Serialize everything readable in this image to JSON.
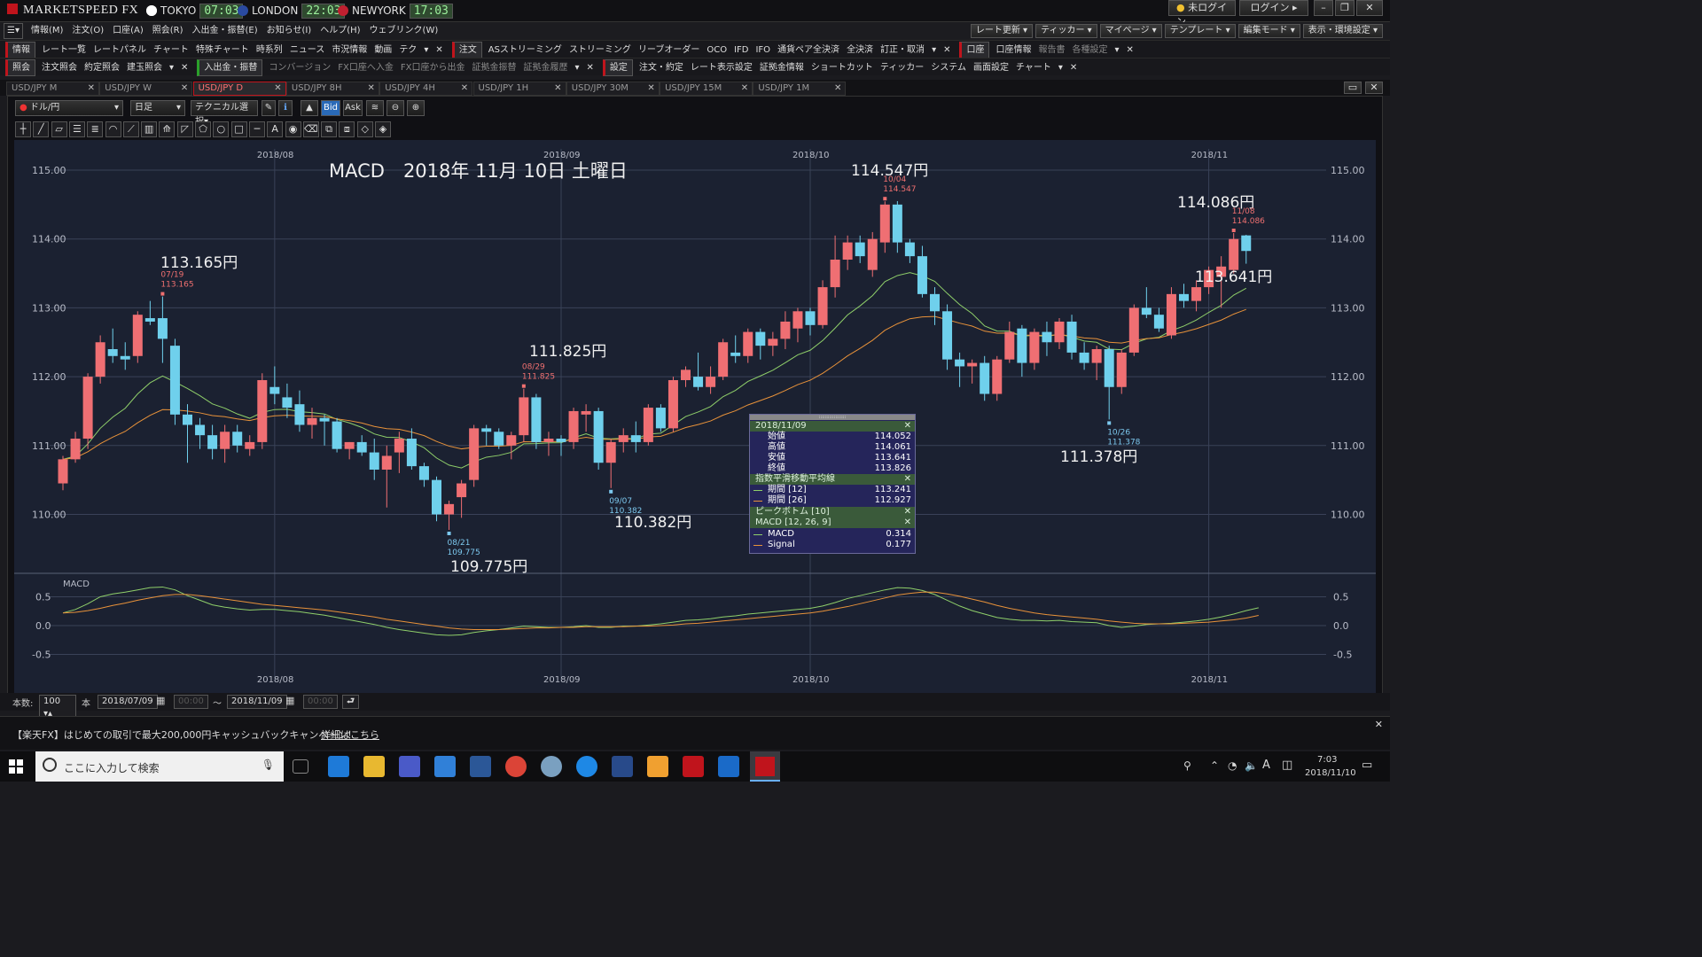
{
  "app": {
    "title": "MARKETSPEED FX",
    "clocks": [
      {
        "city": "TOKYO",
        "time": "07:03",
        "flag_color": "#e02020"
      },
      {
        "city": "LONDON",
        "time": "22:03",
        "flag_color": "#2a4aa0"
      },
      {
        "city": "NEWYORK",
        "time": "17:03",
        "flag_color": "#c02030"
      }
    ],
    "login_status": "未ログイン",
    "login_button": "ログイン",
    "menu": [
      "情報(M)",
      "注文(O)",
      "口座(A)",
      "照会(R)",
      "入出金・振替(E)",
      "お知らせ(I)",
      "ヘルプ(H)",
      "ウェブリンク(W)"
    ],
    "right_buttons": [
      "レート更新",
      "ティッカー",
      "マイページ",
      "テンプレート",
      "編集モード",
      "表示・環境設定"
    ]
  },
  "toolbar1": {
    "info_head": "情報",
    "info_items": [
      "レート一覧",
      "レートパネル",
      "チャート",
      "特殊チャート",
      "時系列",
      "ニュース",
      "市況情報",
      "動画",
      "テク"
    ],
    "order_head": "注文",
    "order_items": [
      "ASストリーミング",
      "ストリーミング",
      "リーブオーダー",
      "OCO",
      "IFD",
      "IFO",
      "通貨ペア全決済",
      "全決済",
      "訂正・取消"
    ],
    "account_head": "口座",
    "account_items": [
      "口座情報",
      "報告書",
      "各種設定"
    ]
  },
  "toolbar2": {
    "inquiry_head": "照会",
    "inquiry_items": [
      "注文照会",
      "約定照会",
      "建玉照会"
    ],
    "deposit_head": "入出金・振替",
    "deposit_items": [
      "コンバージョン",
      "FX口座へ入金",
      "FX口座から出金",
      "証拠金振替",
      "証拠金履歴"
    ],
    "settings_head": "設定",
    "settings_items": [
      "注文・約定",
      "レート表示設定",
      "証拠金情報",
      "ショートカット",
      "ティッカー",
      "システム",
      "画面設定",
      "チャート"
    ]
  },
  "tabs": [
    {
      "label": "USD/JPY M",
      "active": false
    },
    {
      "label": "USD/JPY W",
      "active": false
    },
    {
      "label": "USD/JPY D",
      "active": true
    },
    {
      "label": "USD/JPY 8H",
      "active": false
    },
    {
      "label": "USD/JPY 4H",
      "active": false
    },
    {
      "label": "USD/JPY 1H",
      "active": false
    },
    {
      "label": "USD/JPY 30M",
      "active": false
    },
    {
      "label": "USD/JPY 15M",
      "active": false
    },
    {
      "label": "USD/JPY 1M",
      "active": false
    }
  ],
  "chart_controls": {
    "pair": "ドル/円",
    "period": "日足",
    "technical": "テクニカル選択",
    "bid": "Bid",
    "ask": "Ask"
  },
  "annotations": {
    "title": "MACD　2018年 11月 10日 土曜日",
    "labels": [
      {
        "text": "113.165円"
      },
      {
        "text": "111.825円"
      },
      {
        "text": "114.547円"
      },
      {
        "text": "114.086円"
      },
      {
        "text": "113.641円"
      },
      {
        "text": "110.382円"
      },
      {
        "text": "109.775円"
      },
      {
        "text": "111.378円"
      }
    ],
    "peaks": [
      {
        "date": "07/19",
        "value": "113.165",
        "kind": "high"
      },
      {
        "date": "08/29",
        "value": "111.825",
        "kind": "high"
      },
      {
        "date": "10/04",
        "value": "114.547",
        "kind": "high"
      },
      {
        "date": "11/08",
        "value": "114.086",
        "kind": "high"
      },
      {
        "date": "08/21",
        "value": "109.775",
        "kind": "low"
      },
      {
        "date": "09/07",
        "value": "110.382",
        "kind": "low"
      },
      {
        "date": "10/26",
        "value": "111.378",
        "kind": "low"
      }
    ]
  },
  "data_window": {
    "date": "2018/11/09",
    "ohlc": [
      {
        "label": "始値",
        "value": "114.052"
      },
      {
        "label": "高値",
        "value": "114.061"
      },
      {
        "label": "安値",
        "value": "113.641"
      },
      {
        "label": "終値",
        "value": "113.826"
      }
    ],
    "ema_title": "指数平滑移動平均線",
    "ema": [
      {
        "label": "期間 [12]",
        "value": "113.241"
      },
      {
        "label": "期間 [26]",
        "value": "112.927"
      }
    ],
    "peak_title": "ピークボトム [10]",
    "macd_title": "MACD [12, 26, 9]",
    "macd": [
      {
        "label": "MACD",
        "value": "0.314"
      },
      {
        "label": "Signal",
        "value": "0.177"
      }
    ]
  },
  "bottom": {
    "count_label": "本数:",
    "count": "100",
    "unit": "本",
    "from": "2018/07/09",
    "to": "2018/11/09",
    "time_placeholder": "00:00",
    "tilde": "～"
  },
  "news": {
    "text": "【楽天FX】はじめての取引で最大200,000円キャッシュバックキャンペーン！",
    "link": "詳細はこちら"
  },
  "taskbar": {
    "search": "ここに入力して検索",
    "time": "7:03",
    "date": "2018/11/10"
  },
  "colors": {
    "up": "#ef6f73",
    "down": "#6fd0ec",
    "ema12": "#8fcf6a",
    "ema26": "#e8923a",
    "bg": "#1b2131",
    "grid": "#3a4258"
  },
  "chart_data": {
    "type": "candlestick",
    "title": "MACD　2018年 11月 10日 土曜日",
    "pair": "USD/JPY",
    "timeframe": "日足",
    "x_month_labels": [
      "2018/08",
      "2018/09",
      "2018/10",
      "2018/11"
    ],
    "ylim": [
      109.5,
      115.2
    ],
    "yticks": [
      "110.00",
      "111.00",
      "112.00",
      "113.00",
      "114.00",
      "115.00"
    ],
    "candles": [
      {
        "o": 110.45,
        "h": 110.85,
        "l": 110.35,
        "c": 110.8
      },
      {
        "o": 110.8,
        "h": 111.2,
        "l": 110.75,
        "c": 111.1
      },
      {
        "o": 111.1,
        "h": 112.05,
        "l": 110.95,
        "c": 112.0
      },
      {
        "o": 112.0,
        "h": 112.6,
        "l": 111.9,
        "c": 112.5
      },
      {
        "o": 112.4,
        "h": 112.7,
        "l": 112.2,
        "c": 112.3
      },
      {
        "o": 112.3,
        "h": 112.5,
        "l": 112.1,
        "c": 112.25
      },
      {
        "o": 112.3,
        "h": 112.95,
        "l": 112.2,
        "c": 112.9
      },
      {
        "o": 112.85,
        "h": 113.1,
        "l": 112.75,
        "c": 112.8
      },
      {
        "o": 112.85,
        "h": 113.165,
        "l": 112.2,
        "c": 112.55
      },
      {
        "o": 112.45,
        "h": 112.55,
        "l": 111.3,
        "c": 111.45
      },
      {
        "o": 111.45,
        "h": 111.6,
        "l": 110.75,
        "c": 111.3
      },
      {
        "o": 111.3,
        "h": 111.4,
        "l": 110.95,
        "c": 111.15
      },
      {
        "o": 111.15,
        "h": 111.3,
        "l": 110.8,
        "c": 110.95
      },
      {
        "o": 110.95,
        "h": 111.3,
        "l": 110.75,
        "c": 111.2
      },
      {
        "o": 111.2,
        "h": 111.3,
        "l": 110.9,
        "c": 111.0
      },
      {
        "o": 110.95,
        "h": 111.15,
        "l": 110.85,
        "c": 111.05
      },
      {
        "o": 111.05,
        "h": 112.05,
        "l": 110.95,
        "c": 111.95
      },
      {
        "o": 111.85,
        "h": 112.15,
        "l": 111.6,
        "c": 111.75
      },
      {
        "o": 111.7,
        "h": 111.9,
        "l": 111.4,
        "c": 111.55
      },
      {
        "o": 111.6,
        "h": 111.8,
        "l": 111.2,
        "c": 111.3
      },
      {
        "o": 111.3,
        "h": 111.55,
        "l": 111.1,
        "c": 111.4
      },
      {
        "o": 111.4,
        "h": 111.45,
        "l": 111.0,
        "c": 111.35
      },
      {
        "o": 111.35,
        "h": 111.4,
        "l": 110.9,
        "c": 110.95
      },
      {
        "o": 110.95,
        "h": 111.05,
        "l": 110.8,
        "c": 111.05
      },
      {
        "o": 111.05,
        "h": 111.15,
        "l": 110.85,
        "c": 110.9
      },
      {
        "o": 110.9,
        "h": 111.1,
        "l": 110.5,
        "c": 110.65
      },
      {
        "o": 110.65,
        "h": 111.0,
        "l": 110.1,
        "c": 110.85
      },
      {
        "o": 110.9,
        "h": 111.2,
        "l": 110.6,
        "c": 111.1
      },
      {
        "o": 111.1,
        "h": 111.25,
        "l": 110.65,
        "c": 110.7
      },
      {
        "o": 110.7,
        "h": 110.75,
        "l": 110.4,
        "c": 110.5
      },
      {
        "o": 110.5,
        "h": 110.55,
        "l": 109.9,
        "c": 110.0
      },
      {
        "o": 110.0,
        "h": 110.2,
        "l": 109.775,
        "c": 110.15
      },
      {
        "o": 110.25,
        "h": 110.5,
        "l": 109.95,
        "c": 110.45
      },
      {
        "o": 110.5,
        "h": 111.3,
        "l": 110.4,
        "c": 111.25
      },
      {
        "o": 111.25,
        "h": 111.3,
        "l": 111.0,
        "c": 111.2
      },
      {
        "o": 111.2,
        "h": 111.25,
        "l": 110.95,
        "c": 111.0
      },
      {
        "o": 111.0,
        "h": 111.2,
        "l": 110.8,
        "c": 111.15
      },
      {
        "o": 111.15,
        "h": 111.825,
        "l": 111.05,
        "c": 111.7
      },
      {
        "o": 111.7,
        "h": 111.75,
        "l": 110.95,
        "c": 111.05
      },
      {
        "o": 111.05,
        "h": 111.2,
        "l": 110.85,
        "c": 111.1
      },
      {
        "o": 111.1,
        "h": 111.15,
        "l": 110.85,
        "c": 111.05
      },
      {
        "o": 111.05,
        "h": 111.55,
        "l": 110.95,
        "c": 111.5
      },
      {
        "o": 111.45,
        "h": 111.6,
        "l": 111.2,
        "c": 111.5
      },
      {
        "o": 111.5,
        "h": 111.55,
        "l": 110.65,
        "c": 110.75
      },
      {
        "o": 110.75,
        "h": 111.1,
        "l": 110.382,
        "c": 111.05
      },
      {
        "o": 111.05,
        "h": 111.25,
        "l": 110.9,
        "c": 111.15
      },
      {
        "o": 111.15,
        "h": 111.35,
        "l": 110.9,
        "c": 111.05
      },
      {
        "o": 111.05,
        "h": 111.6,
        "l": 111.0,
        "c": 111.55
      },
      {
        "o": 111.55,
        "h": 111.6,
        "l": 111.2,
        "c": 111.25
      },
      {
        "o": 111.25,
        "h": 112.0,
        "l": 111.2,
        "c": 111.95
      },
      {
        "o": 111.95,
        "h": 112.15,
        "l": 111.85,
        "c": 112.1
      },
      {
        "o": 112.0,
        "h": 112.35,
        "l": 111.8,
        "c": 111.85
      },
      {
        "o": 111.85,
        "h": 112.15,
        "l": 111.75,
        "c": 112.0
      },
      {
        "o": 112.0,
        "h": 112.55,
        "l": 111.95,
        "c": 112.5
      },
      {
        "o": 112.35,
        "h": 112.6,
        "l": 112.2,
        "c": 112.3
      },
      {
        "o": 112.3,
        "h": 112.7,
        "l": 112.2,
        "c": 112.65
      },
      {
        "o": 112.65,
        "h": 112.7,
        "l": 112.25,
        "c": 112.45
      },
      {
        "o": 112.45,
        "h": 112.65,
        "l": 112.3,
        "c": 112.55
      },
      {
        "o": 112.55,
        "h": 112.95,
        "l": 112.4,
        "c": 112.8
      },
      {
        "o": 112.7,
        "h": 113.0,
        "l": 112.5,
        "c": 112.95
      },
      {
        "o": 112.95,
        "h": 113.0,
        "l": 112.6,
        "c": 112.75
      },
      {
        "o": 112.75,
        "h": 113.4,
        "l": 112.7,
        "c": 113.3
      },
      {
        "o": 113.3,
        "h": 114.05,
        "l": 113.15,
        "c": 113.7
      },
      {
        "o": 113.7,
        "h": 114.05,
        "l": 113.55,
        "c": 113.95
      },
      {
        "o": 113.95,
        "h": 114.05,
        "l": 113.65,
        "c": 113.75
      },
      {
        "o": 113.55,
        "h": 114.1,
        "l": 113.45,
        "c": 114.0
      },
      {
        "o": 113.95,
        "h": 114.547,
        "l": 113.8,
        "c": 114.5
      },
      {
        "o": 114.5,
        "h": 114.55,
        "l": 113.8,
        "c": 113.95
      },
      {
        "o": 113.95,
        "h": 114.0,
        "l": 113.65,
        "c": 113.75
      },
      {
        "o": 113.75,
        "h": 113.9,
        "l": 113.15,
        "c": 113.2
      },
      {
        "o": 113.2,
        "h": 113.3,
        "l": 112.75,
        "c": 112.95
      },
      {
        "o": 112.95,
        "h": 113.05,
        "l": 112.1,
        "c": 112.25
      },
      {
        "o": 112.25,
        "h": 112.35,
        "l": 111.85,
        "c": 112.15
      },
      {
        "o": 112.15,
        "h": 112.25,
        "l": 111.9,
        "c": 112.2
      },
      {
        "o": 112.2,
        "h": 112.3,
        "l": 111.65,
        "c": 111.75
      },
      {
        "o": 111.75,
        "h": 112.3,
        "l": 111.65,
        "c": 112.25
      },
      {
        "o": 112.25,
        "h": 112.8,
        "l": 112.2,
        "c": 112.65
      },
      {
        "o": 112.7,
        "h": 112.75,
        "l": 112.0,
        "c": 112.2
      },
      {
        "o": 112.2,
        "h": 112.7,
        "l": 112.1,
        "c": 112.65
      },
      {
        "o": 112.65,
        "h": 112.8,
        "l": 112.3,
        "c": 112.5
      },
      {
        "o": 112.5,
        "h": 112.85,
        "l": 112.4,
        "c": 112.8
      },
      {
        "o": 112.8,
        "h": 112.9,
        "l": 112.25,
        "c": 112.35
      },
      {
        "o": 112.35,
        "h": 112.5,
        "l": 112.1,
        "c": 112.2
      },
      {
        "o": 112.2,
        "h": 112.45,
        "l": 111.95,
        "c": 112.4
      },
      {
        "o": 112.4,
        "h": 112.45,
        "l": 111.378,
        "c": 111.85
      },
      {
        "o": 111.85,
        "h": 112.4,
        "l": 111.75,
        "c": 112.35
      },
      {
        "o": 112.35,
        "h": 113.05,
        "l": 112.3,
        "c": 113.0
      },
      {
        "o": 113.0,
        "h": 113.3,
        "l": 112.85,
        "c": 112.9
      },
      {
        "o": 112.9,
        "h": 113.0,
        "l": 112.65,
        "c": 112.7
      },
      {
        "o": 112.6,
        "h": 113.3,
        "l": 112.55,
        "c": 113.2
      },
      {
        "o": 113.2,
        "h": 113.35,
        "l": 113.0,
        "c": 113.1
      },
      {
        "o": 113.1,
        "h": 113.4,
        "l": 112.95,
        "c": 113.3
      },
      {
        "o": 113.3,
        "h": 113.6,
        "l": 113.2,
        "c": 113.55
      },
      {
        "o": 113.45,
        "h": 113.75,
        "l": 113.0,
        "c": 113.6
      },
      {
        "o": 113.55,
        "h": 114.086,
        "l": 113.5,
        "c": 114.0
      },
      {
        "o": 114.052,
        "h": 114.061,
        "l": 113.641,
        "c": 113.826
      }
    ],
    "ema12_end": 113.241,
    "ema26_end": 112.927,
    "macd_panel": {
      "label": "MACD",
      "yticks": [
        "0.5",
        "0.0",
        "-0.5"
      ],
      "ylim": [
        -0.7,
        0.7
      ],
      "macd_end": 0.314,
      "signal_end": 0.177,
      "series": [
        {
          "name": "MACD",
          "values": [
            0.22,
            0.28,
            0.38,
            0.5,
            0.55,
            0.58,
            0.62,
            0.66,
            0.67,
            0.62,
            0.52,
            0.44,
            0.36,
            0.32,
            0.29,
            0.27,
            0.28,
            0.28,
            0.26,
            0.24,
            0.21,
            0.18,
            0.14,
            0.1,
            0.06,
            0.02,
            -0.03,
            -0.07,
            -0.1,
            -0.13,
            -0.16,
            -0.17,
            -0.16,
            -0.12,
            -0.09,
            -0.07,
            -0.04,
            -0.01,
            -0.02,
            -0.03,
            -0.03,
            -0.02,
            0.0,
            -0.03,
            -0.03,
            -0.01,
            -0.01,
            0.01,
            0.03,
            0.06,
            0.09,
            0.1,
            0.12,
            0.15,
            0.17,
            0.2,
            0.22,
            0.24,
            0.26,
            0.28,
            0.3,
            0.34,
            0.4,
            0.47,
            0.52,
            0.57,
            0.62,
            0.66,
            0.65,
            0.61,
            0.54,
            0.44,
            0.34,
            0.26,
            0.2,
            0.14,
            0.11,
            0.09,
            0.09,
            0.08,
            0.09,
            0.07,
            0.06,
            0.05,
            0.0,
            -0.03,
            -0.01,
            0.02,
            0.03,
            0.04,
            0.06,
            0.08,
            0.11,
            0.15,
            0.2,
            0.26,
            0.31
          ]
        },
        {
          "name": "Signal",
          "values": [
            0.22,
            0.23,
            0.26,
            0.3,
            0.35,
            0.39,
            0.44,
            0.48,
            0.52,
            0.54,
            0.54,
            0.52,
            0.49,
            0.46,
            0.43,
            0.4,
            0.37,
            0.35,
            0.33,
            0.31,
            0.29,
            0.27,
            0.24,
            0.21,
            0.18,
            0.15,
            0.11,
            0.08,
            0.05,
            0.02,
            -0.01,
            -0.04,
            -0.06,
            -0.07,
            -0.07,
            -0.07,
            -0.06,
            -0.05,
            -0.04,
            -0.04,
            -0.03,
            -0.03,
            -0.02,
            -0.02,
            -0.02,
            -0.02,
            -0.01,
            -0.01,
            0.0,
            0.01,
            0.03,
            0.04,
            0.06,
            0.08,
            0.1,
            0.12,
            0.14,
            0.16,
            0.18,
            0.2,
            0.22,
            0.25,
            0.29,
            0.33,
            0.38,
            0.43,
            0.48,
            0.53,
            0.56,
            0.58,
            0.58,
            0.55,
            0.51,
            0.46,
            0.41,
            0.35,
            0.3,
            0.26,
            0.22,
            0.19,
            0.17,
            0.15,
            0.13,
            0.11,
            0.08,
            0.06,
            0.04,
            0.03,
            0.03,
            0.03,
            0.04,
            0.05,
            0.06,
            0.08,
            0.1,
            0.13,
            0.177
          ]
        }
      ]
    }
  }
}
